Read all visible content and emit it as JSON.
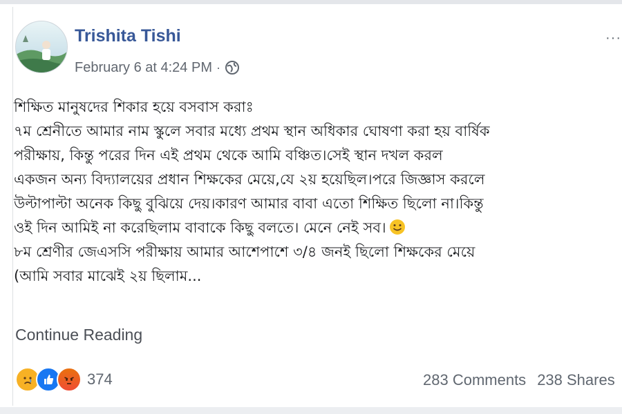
{
  "post": {
    "author_name": "Trishita Tishi",
    "timestamp": "February 6 at 4:24 PM",
    "separator": "·",
    "more_label": "···",
    "body_lines": [
      "শিক্ষিত মানুষদের শিকার হয়ে বসবাস করাঃ",
      "৭ম শ্রেনীতে আমার নাম স্কুলে সবার মধ্যে প্রথম স্থান অধিকার ঘোষণা করা হয় বার্ষিক",
      "পরীক্ষায়, কিন্তু পরের দিন এই প্রথম থেকে আমি বঞ্চিত।সেই স্থান দখল করল",
      "একজন অন্য বিদ্যালয়ের প্রধান শিক্ষকের মেয়ে,যে ২য় হয়েছিল।পরে জিজ্ঞাস করলে",
      "উল্টাপাল্টা অনেক কিছু বুঝিয়ে দেয়।কারণ আমার বাবা এতো শিক্ষিত ছিলো না।কিন্তু",
      "ওই দিন আমিই না করেছিলাম বাবাকে কিছু বলতে। মেনে নেই সব।",
      "৮ম শ্রেণীর জেএসসি পরীক্ষায় আমার আশেপাশে ৩/৪ জনই ছিলো শিক্ষকের মেয়ে",
      "(আমি সবার মাঝেই ২য় ছিলাম..."
    ],
    "continue_label": "Continue Reading",
    "reaction_icons": [
      "sad-react-icon",
      "like-react-icon",
      "angry-react-icon"
    ],
    "reaction_count": "374",
    "comments": "283 Comments",
    "shares": "238 Shares"
  },
  "colors": {
    "author": "#385898",
    "meta": "#616770",
    "like": "#1877f2",
    "sad": "#f7b125",
    "angry": "#e9710f"
  }
}
